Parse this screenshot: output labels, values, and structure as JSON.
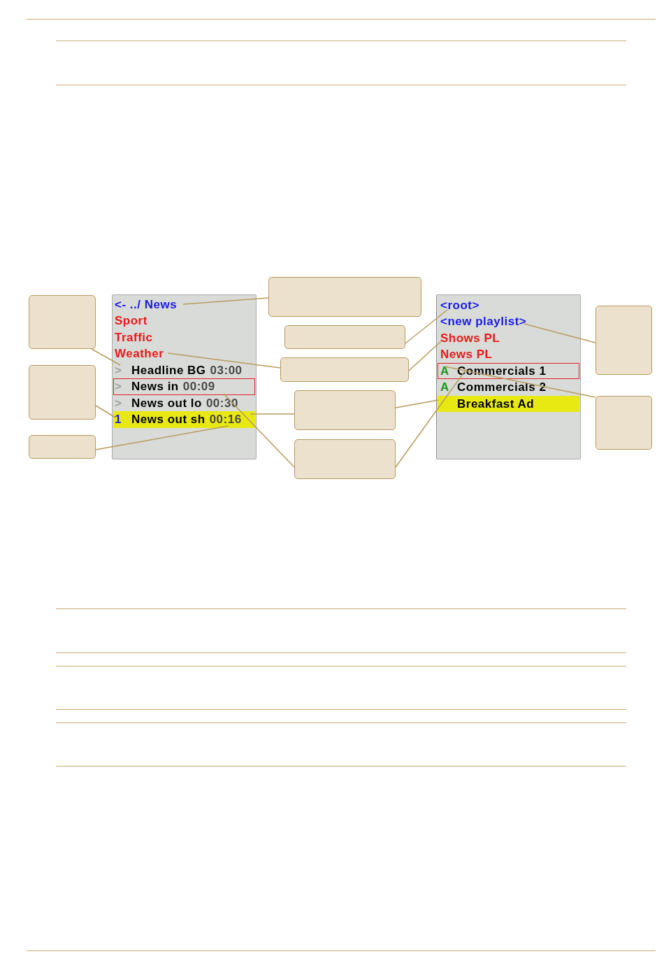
{
  "figure": {
    "left_panel": {
      "items": [
        {
          "kind": "link",
          "label": "<- ../ News"
        },
        {
          "kind": "folder",
          "label": "Sport"
        },
        {
          "kind": "folder",
          "label": "Traffic"
        },
        {
          "kind": "folder",
          "label": "Weather"
        },
        {
          "kind": "clip",
          "marker": {
            "text": ">",
            "color": "#a0a0a0"
          },
          "name": "Headline BG",
          "duration": "03:00",
          "selected": false,
          "focused": false
        },
        {
          "kind": "clip",
          "marker": {
            "text": ">",
            "color": "#a0a0a0"
          },
          "name": "News in",
          "duration": "00:09",
          "selected": false,
          "focused": true
        },
        {
          "kind": "clip",
          "marker": {
            "text": ">",
            "color": "#a0a0a0"
          },
          "name": "News out lo",
          "duration": "00:30",
          "selected": false,
          "focused": false
        },
        {
          "kind": "clip",
          "marker": {
            "text": "1",
            "color": "#1c1ce8"
          },
          "name": "News out sh",
          "duration": "00:16",
          "selected": true,
          "focused": false
        }
      ]
    },
    "right_panel": {
      "items": [
        {
          "kind": "link",
          "label": "<root>"
        },
        {
          "kind": "link",
          "label": "<new playlist>"
        },
        {
          "kind": "folder",
          "label": "Shows PL"
        },
        {
          "kind": "folder",
          "label": "News PL"
        },
        {
          "kind": "clip",
          "marker": {
            "text": "A",
            "color": "#1a9a1a"
          },
          "name": "Commercials 1",
          "selected": false,
          "focused": true
        },
        {
          "kind": "clip",
          "marker": {
            "text": "A",
            "color": "#1a9a1a"
          },
          "name": "Commercials 2",
          "selected": false,
          "focused": false
        },
        {
          "kind": "clip",
          "name": "Breakfast Ad",
          "selected": true,
          "focused": false
        }
      ]
    }
  }
}
